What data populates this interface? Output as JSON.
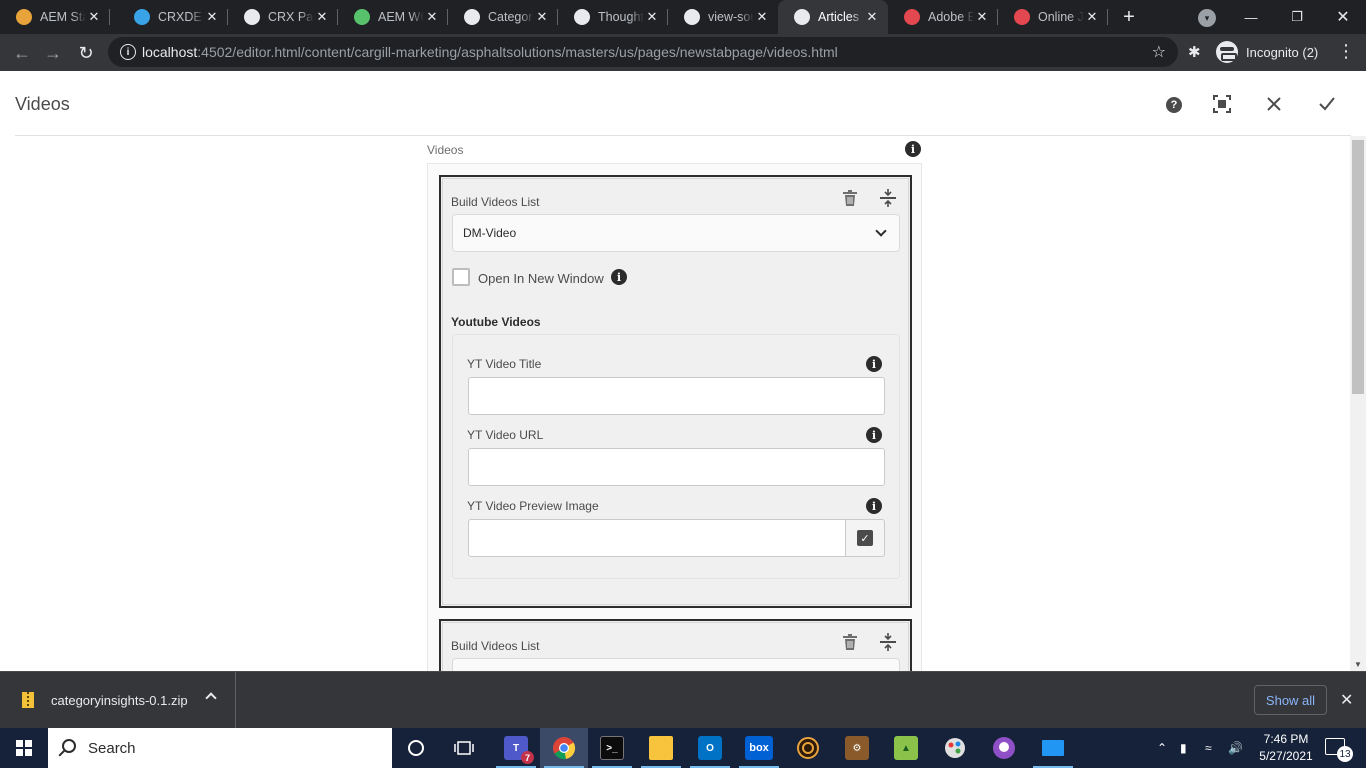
{
  "browser": {
    "tabs": [
      {
        "title": "AEM Sta",
        "favicon": "aem-icon",
        "color": "#e8a33a"
      },
      {
        "title": "CRXDE L",
        "favicon": "crxde-icon",
        "color": "#3aa3e8"
      },
      {
        "title": "CRX Pac",
        "favicon": "globe-icon",
        "color": "#e8eaed"
      },
      {
        "title": "AEM WC",
        "favicon": "earth-icon",
        "color": "#57c26b"
      },
      {
        "title": "Categor",
        "favicon": "globe-icon",
        "color": "#e8eaed"
      },
      {
        "title": "Thought",
        "favicon": "globe-icon",
        "color": "#e8eaed"
      },
      {
        "title": "view-sou",
        "favicon": "globe-icon",
        "color": "#e8eaed"
      },
      {
        "title": "Articles",
        "favicon": "globe-icon",
        "color": "#e8eaed",
        "active": true
      },
      {
        "title": "Adobe E",
        "favicon": "adobe-icon",
        "color": "#e34850"
      },
      {
        "title": "Online J",
        "favicon": "online-icon",
        "color": "#e34850"
      }
    ],
    "url_host": "localhost",
    "url_rest": ":4502/editor.html/content/cargill-marketing/asphaltsolutions/masters/us/pages/newstabpage/videos.html",
    "profile": "Incognito (2)"
  },
  "dialog": {
    "title": "Videos",
    "multifield_label": "Videos",
    "items": [
      {
        "build_label": "Build Videos List",
        "select_value": "DM-Video",
        "checkbox_label": "Open In New Window",
        "section_title": "Youtube Videos",
        "fields": {
          "title_label": "YT Video Title",
          "url_label": "YT Video URL",
          "image_label": "YT Video Preview Image"
        }
      },
      {
        "build_label": "Build Videos List"
      }
    ]
  },
  "downloads": {
    "filename": "categoryinsights-0.1.zip",
    "show_all": "Show all"
  },
  "taskbar": {
    "search_placeholder": "Search",
    "time": "7:46 PM",
    "date": "5/27/2021",
    "notifications": "13",
    "teams_badge": "7"
  }
}
